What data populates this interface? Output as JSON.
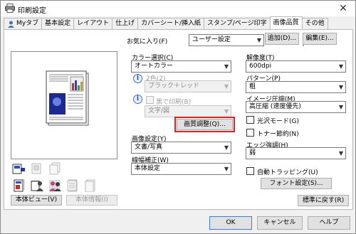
{
  "window": {
    "title": "印刷設定"
  },
  "tabs": [
    {
      "label": "Myタブ",
      "active": false
    },
    {
      "label": "基本設定",
      "active": false
    },
    {
      "label": "レイアウト",
      "active": false
    },
    {
      "label": "仕上げ",
      "active": false
    },
    {
      "label": "カバーシート/挿入紙",
      "active": false
    },
    {
      "label": "スタンプ/ページ印字",
      "active": false
    },
    {
      "label": "画像品質",
      "active": true
    },
    {
      "label": "その他",
      "active": false
    }
  ],
  "favorites": {
    "label": "お気に入り(F)",
    "value": "ユーザー設定",
    "add_button": "追加(D)...",
    "edit_button": "編集(E)..."
  },
  "preview": {
    "view_button": "本体ビュー(V)",
    "info_button": "本体情報(I)"
  },
  "color": {
    "select_label": "カラー選択(C)",
    "select_value": "オートカラー",
    "two_color_label": "2色(2)",
    "two_color_value": "ブラック＋レッド",
    "black_print_label": "黒で印刷(B)",
    "black_print_value": "文字/図"
  },
  "quality_button": "画質調整(Q)...",
  "image_settings": {
    "label": "画像設定(Y)",
    "value": "文書/写真"
  },
  "line_width": {
    "label": "線幅補正(W)",
    "value": "本体設定"
  },
  "resolution": {
    "label": "解像度(T)",
    "value": "600dpi"
  },
  "pattern": {
    "label": "パターン(P)",
    "value": "粗"
  },
  "compression": {
    "label": "イメージ圧縮(M)",
    "value": "高圧縮 (速度優先)"
  },
  "gloss_mode": {
    "label": "光沢モード(G)",
    "checked": false
  },
  "toner_save": {
    "label": "トナー節約(N)",
    "checked": false
  },
  "edge": {
    "label": "エッジ強調(H)",
    "value": "弱"
  },
  "auto_trapping": {
    "label": "自動トラッピング(U)",
    "checked": false
  },
  "font_settings_button": "フォント設定(S)...",
  "default_button": "標準に戻す(R)",
  "footer": {
    "ok": "OK",
    "cancel": "キャンセル",
    "help": "ヘルプ"
  },
  "colors": {
    "highlight": "#e02020",
    "tab_active_bg": "#ffffff",
    "button_bg": "#e1e1e1"
  }
}
